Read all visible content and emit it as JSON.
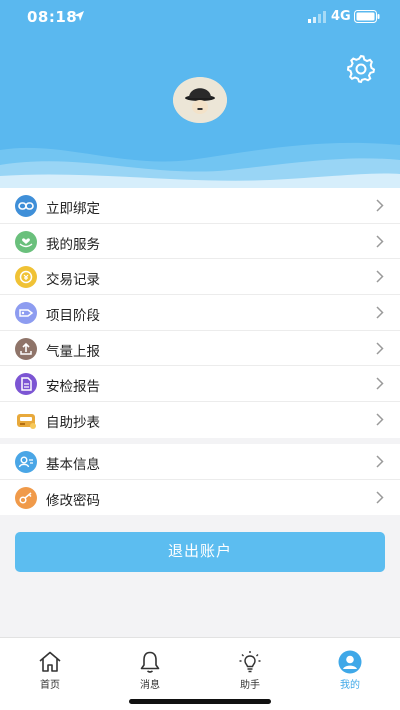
{
  "status_bar": {
    "time": "08:18",
    "network": "4G"
  },
  "colors": {
    "primary": "#5ab8ef",
    "button": "#5cbdf0",
    "active_tab": "#3fa8e8"
  },
  "header": {
    "settings_icon": "gear-icon",
    "avatar_icon": "avatar-icon"
  },
  "menu_group1": [
    {
      "label": "立即绑定",
      "icon": "link-icon",
      "color": "#3f8fd8"
    },
    {
      "label": "我的服务",
      "icon": "hands-heart-icon",
      "color": "#6ac07c"
    },
    {
      "label": "交易记录",
      "icon": "coin-icon",
      "color": "#f0c235"
    },
    {
      "label": "项目阶段",
      "icon": "tag-icon",
      "color": "#8d9cf0"
    },
    {
      "label": "气量上报",
      "icon": "upload-icon",
      "color": "#8f7469"
    },
    {
      "label": "安检报告",
      "icon": "document-icon",
      "color": "#7c55d3"
    },
    {
      "label": "自助抄表",
      "icon": "meter-icon",
      "color": "#e8a93b"
    }
  ],
  "menu_group2": [
    {
      "label": "基本信息",
      "icon": "user-info-icon",
      "color": "#4aa6e6"
    },
    {
      "label": "修改密码",
      "icon": "key-icon",
      "color": "#f09a4a"
    }
  ],
  "logout_label": "退出账户",
  "tabs": [
    {
      "label": "首页",
      "icon": "home-icon",
      "active": false
    },
    {
      "label": "消息",
      "icon": "bell-icon",
      "active": false
    },
    {
      "label": "助手",
      "icon": "lightbulb-icon",
      "active": false
    },
    {
      "label": "我的",
      "icon": "profile-icon",
      "active": true
    }
  ]
}
